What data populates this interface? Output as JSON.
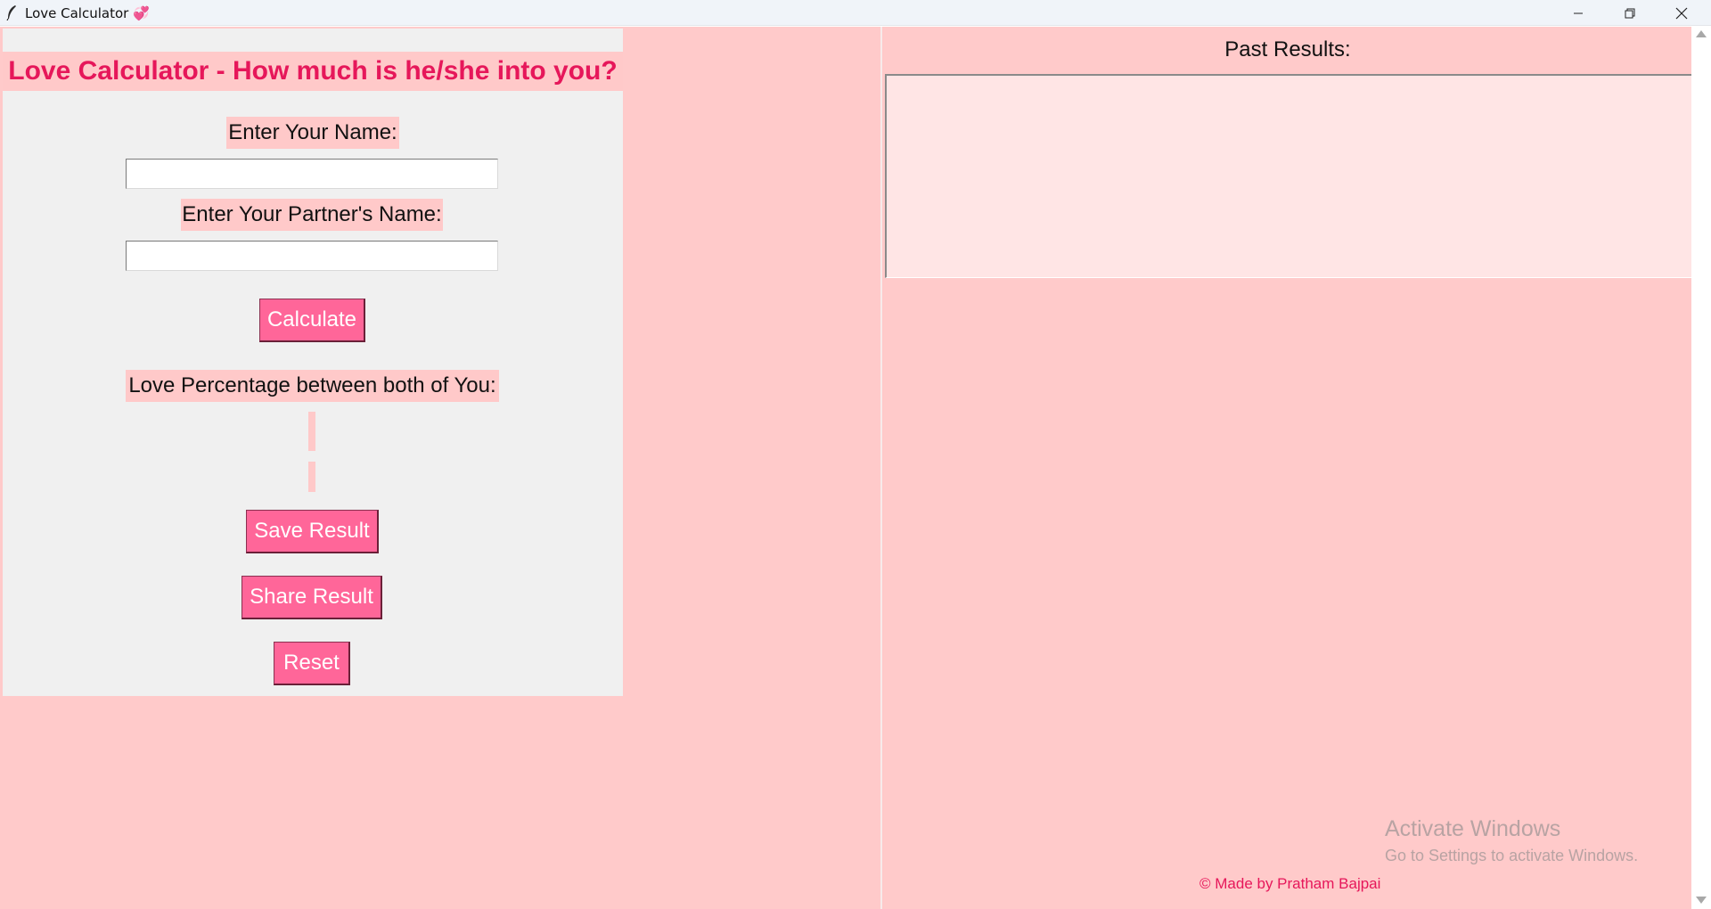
{
  "window": {
    "title": "Love Calculator 💞",
    "controls": [
      "minimize",
      "restore",
      "close"
    ]
  },
  "form": {
    "heading": "Love Calculator - How much is he/she into you?",
    "name_label": "Enter Your Name:",
    "name_value": "",
    "partner_label": "Enter Your Partner's Name:",
    "partner_value": "",
    "calculate_label": "Calculate",
    "percentage_label": "Love Percentage between both of You:",
    "percentage_value": "",
    "message_value": "",
    "save_label": "Save Result",
    "share_label": "Share Result",
    "reset_label": "Reset"
  },
  "history": {
    "title": "Past Results:",
    "items": []
  },
  "footer": {
    "credit": "© Made by Pratham Bajpai"
  },
  "watermark": {
    "line1": "Activate Windows",
    "line2": "Go to Settings to activate Windows."
  },
  "colors": {
    "background": "#ffc9c9",
    "heading": "#e6175a",
    "button": "#ff6699",
    "panel": "#f0f0f0",
    "history_box": "#ffe5e5"
  }
}
